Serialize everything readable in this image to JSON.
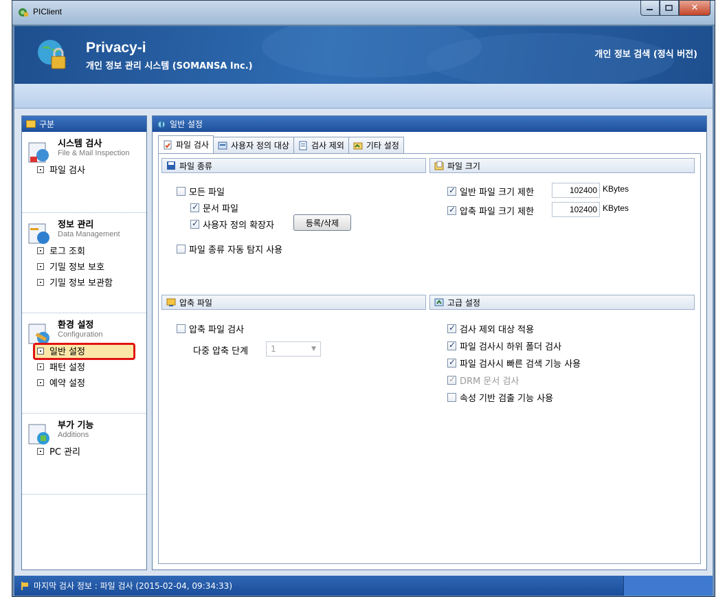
{
  "window": {
    "title": "PIClient"
  },
  "banner": {
    "brand": "Privacy-i",
    "subtitle": "개인 정보 관리 시스템 (SOMANSA Inc.)",
    "right_text": "개인 정보 검색 (정식 버전)"
  },
  "sidebar": {
    "header": "구분",
    "groups": [
      {
        "title": "시스템 검사",
        "subtitle": "File & Mail Inspection",
        "items": [
          "파일 검사"
        ]
      },
      {
        "title": "정보 관리",
        "subtitle": "Data Management",
        "items": [
          "로그 조회",
          "기밀 정보 보호",
          "기밀 정보 보관함"
        ]
      },
      {
        "title": "환경 설정",
        "subtitle": "Configuration",
        "items": [
          "일반 설정",
          "패턴 설정",
          "예약 설정"
        ]
      },
      {
        "title": "부가 기능",
        "subtitle": "Additions",
        "items": [
          "PC 관리"
        ]
      }
    ],
    "active_item": "일반 설정"
  },
  "main": {
    "header": "일반 설정",
    "tabs": [
      "파일 검사",
      "사용자 정의 대상",
      "검사 제외",
      "기타 설정"
    ],
    "active_tab": "파일 검사",
    "file_type": {
      "title": "파일 종류",
      "all_files": "모든 파일",
      "doc_files": "문서 파일",
      "user_ext": "사용자 정의 확장자",
      "register_button": "등록/삭제",
      "auto_detect": "파일 종류 자동 탐지 사용"
    },
    "file_size": {
      "title": "파일 크기",
      "normal_limit_label": "일반 파일 크기 제한",
      "normal_limit_value": "102400",
      "compressed_limit_label": "압축 파일 크기 제한",
      "compressed_limit_value": "102400",
      "unit": "KBytes"
    },
    "compressed": {
      "title": "압축 파일",
      "inspect_label": "압축 파일 검사",
      "levels_label": "다중 압축 단계",
      "levels_value": "1"
    },
    "advanced": {
      "title": "고급 설정",
      "items": [
        {
          "label": "검사 제외 대상 적용",
          "checked": true,
          "disabled": false
        },
        {
          "label": "파일 검사시 하위 폴더 검사",
          "checked": true,
          "disabled": false
        },
        {
          "label": "파일 검사시 빠른 검색 기능 사용",
          "checked": true,
          "disabled": false
        },
        {
          "label": "DRM 문서 검사",
          "checked": true,
          "disabled": true
        },
        {
          "label": "속성 기반 검출 기능 사용",
          "checked": false,
          "disabled": false
        }
      ]
    }
  },
  "status": {
    "text": "마지막 검사 정보 : 파일 검사 (2015-02-04, 09:34:33)"
  }
}
